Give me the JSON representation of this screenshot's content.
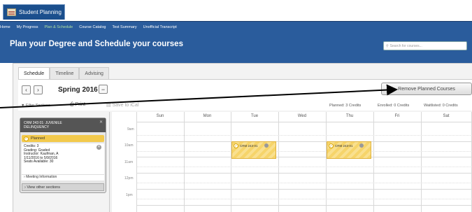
{
  "app": {
    "title": "Student Planning"
  },
  "nav": {
    "items": [
      {
        "label": "Home"
      },
      {
        "label": "My Progress"
      },
      {
        "label": "Plan & Schedule"
      },
      {
        "label": "Course Catalog"
      },
      {
        "label": "Test Summary"
      },
      {
        "label": "Unofficial Transcript"
      }
    ],
    "active": "Plan & Schedule"
  },
  "hero": {
    "title": "Plan your Degree and Schedule your courses",
    "search_placeholder": "Search for courses..."
  },
  "tabs": [
    {
      "label": "Schedule"
    },
    {
      "label": "Timeline"
    },
    {
      "label": "Advising"
    }
  ],
  "term": {
    "name": "Spring 2016",
    "collapse_icon": "−"
  },
  "toolbar": {
    "filter": "Filter Sections",
    "print": "Print",
    "save_ical": "Save to iCal",
    "planned": "Planned: 3 Credits",
    "enrolled": "Enrolled: 0 Credits",
    "waitlisted": "Waitlisted: 0 Credits"
  },
  "remove_button": "Remove Planned Courses",
  "course_card": {
    "title_line1": "CRM 243 01: JUVENILE",
    "title_line2": "DELINQUENCY",
    "status": "Planned",
    "credits": "Credits: 3",
    "grading": "Grading: Graded",
    "instructor": "Instructor: Kaufman, A",
    "dates": "1/11/2016 to 5/9/2016",
    "seats": "Seats Available:  30",
    "meeting_info": "Meeting Information",
    "view_other": "View other sections"
  },
  "calendar": {
    "days": [
      "Sun",
      "Mon",
      "Tue",
      "Wed",
      "Thu",
      "Fri",
      "Sat"
    ],
    "times": [
      "9am",
      "10am",
      "11am",
      "12pm",
      "1pm"
    ],
    "events": [
      {
        "label": "CRM 243-01",
        "day": "Tue",
        "start": "10am"
      },
      {
        "label": "CRM 243-01",
        "day": "Thu",
        "start": "10am"
      }
    ]
  },
  "colors": {
    "header_blue": "#2a5c9c",
    "planned_yellow": "#f2c94c",
    "active_nav": "#aee0a0"
  }
}
